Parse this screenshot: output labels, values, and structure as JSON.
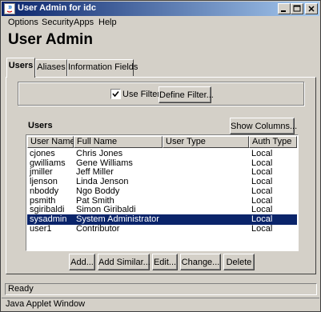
{
  "window": {
    "title": "User Admin for idc"
  },
  "menubar": {
    "items": [
      "Options",
      "Security",
      "Apps",
      "Help"
    ]
  },
  "app_title": "User Admin",
  "tabs": [
    {
      "label": "Users",
      "active": true
    },
    {
      "label": "Aliases",
      "active": false
    },
    {
      "label": "Information Fields",
      "active": false
    }
  ],
  "filter": {
    "use_filter_label": "Use Filter",
    "use_filter_checked": true,
    "define_filter_label": "Define Filter..."
  },
  "users_section": {
    "label": "Users",
    "show_columns_label": "Show Columns..."
  },
  "table": {
    "columns": [
      "User Name",
      "Full Name",
      "User Type",
      "Auth Type"
    ],
    "rows": [
      {
        "user": "cjones",
        "full": "Chris Jones",
        "type": "",
        "auth": "Local",
        "selected": false
      },
      {
        "user": "gwilliams",
        "full": "Gene Williams",
        "type": "",
        "auth": "Local",
        "selected": false
      },
      {
        "user": "jmiller",
        "full": "Jeff Miller",
        "type": "",
        "auth": "Local",
        "selected": false
      },
      {
        "user": "ljenson",
        "full": "Linda Jenson",
        "type": "",
        "auth": "Local",
        "selected": false
      },
      {
        "user": "nboddy",
        "full": "Ngo Boddy",
        "type": "",
        "auth": "Local",
        "selected": false
      },
      {
        "user": "psmith",
        "full": "Pat Smith",
        "type": "",
        "auth": "Local",
        "selected": false
      },
      {
        "user": "sgiribaldi",
        "full": "Simon Giribaldi",
        "type": "",
        "auth": "Local",
        "selected": false
      },
      {
        "user": "sysadmin",
        "full": "System Administrator",
        "type": "",
        "auth": "Local",
        "selected": true
      },
      {
        "user": "user1",
        "full": "Contributor",
        "type": "",
        "auth": "Local",
        "selected": false
      }
    ]
  },
  "actions": {
    "add": "Add...",
    "add_similar": "Add Similar...",
    "edit": "Edit...",
    "change": "Change...",
    "delete": "Delete"
  },
  "status": {
    "text": "Ready"
  },
  "footer": {
    "text": "Java Applet Window"
  },
  "colors": {
    "selection": "#0a246a",
    "titlebar": "#0a246a",
    "face": "#d4d0c8"
  }
}
